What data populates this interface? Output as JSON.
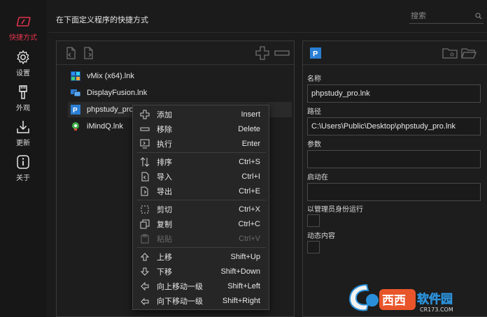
{
  "nav": {
    "items": [
      {
        "label": "快捷方式",
        "icon": "shortcut-icon",
        "active": true
      },
      {
        "label": "设置",
        "icon": "gear-icon",
        "active": false
      },
      {
        "label": "外观",
        "icon": "brush-icon",
        "active": false
      },
      {
        "label": "更新",
        "icon": "download-icon",
        "active": false
      },
      {
        "label": "关于",
        "icon": "info-icon",
        "active": false
      }
    ],
    "accent": "#e0334a"
  },
  "header": {
    "title": "在下面定义程序的快捷方式",
    "search_placeholder": "搜索"
  },
  "list": {
    "items": [
      {
        "label": "vMix (x64).lnk",
        "icon": "vmix-icon"
      },
      {
        "label": "DisplayFusion.lnk",
        "icon": "displayfusion-icon"
      },
      {
        "label": "phpstudy_pro.lnk",
        "icon": "phpstudy-icon",
        "selected": true
      },
      {
        "label": "iMindQ.lnk",
        "icon": "imindq-icon"
      }
    ]
  },
  "detail": {
    "name_label": "名称",
    "name_value": "phpstudy_pro.lnk",
    "path_label": "路径",
    "path_value": "C:\\Users\\Public\\Desktop\\phpstudy_pro.lnk",
    "args_label": "参数",
    "args_value": "",
    "startin_label": "启动在",
    "startin_value": "",
    "admin_label": "以管理员身份运行",
    "dynamic_label": "动态内容"
  },
  "context_menu": {
    "items": [
      {
        "label": "添加",
        "shortcut": "Insert",
        "icon": "plus-icon"
      },
      {
        "label": "移除",
        "shortcut": "Delete",
        "icon": "minus-icon"
      },
      {
        "label": "执行",
        "shortcut": "Enter",
        "icon": "run-icon"
      },
      {
        "label": "排序",
        "shortcut": "Ctrl+S",
        "icon": "sort-icon"
      },
      {
        "label": "导入",
        "shortcut": "Ctrl+I",
        "icon": "import-icon"
      },
      {
        "label": "导出",
        "shortcut": "Ctrl+E",
        "icon": "export-icon"
      },
      {
        "label": "剪切",
        "shortcut": "Ctrl+X",
        "icon": "cut-icon"
      },
      {
        "label": "复制",
        "shortcut": "Ctrl+C",
        "icon": "copy-icon"
      },
      {
        "label": "粘贴",
        "shortcut": "Ctrl+V",
        "icon": "paste-icon",
        "disabled": true
      },
      {
        "label": "上移",
        "shortcut": "Shift+Up",
        "icon": "arrow-up-icon"
      },
      {
        "label": "下移",
        "shortcut": "Shift+Down",
        "icon": "arrow-down-icon"
      },
      {
        "label": "向上移动一级",
        "shortcut": "Shift+Left",
        "icon": "level-up-icon"
      },
      {
        "label": "向下移动一级",
        "shortcut": "Shift+Right",
        "icon": "level-down-icon"
      }
    ]
  },
  "watermark": {
    "brand": "西西软件园",
    "site": "CR173.COM"
  }
}
